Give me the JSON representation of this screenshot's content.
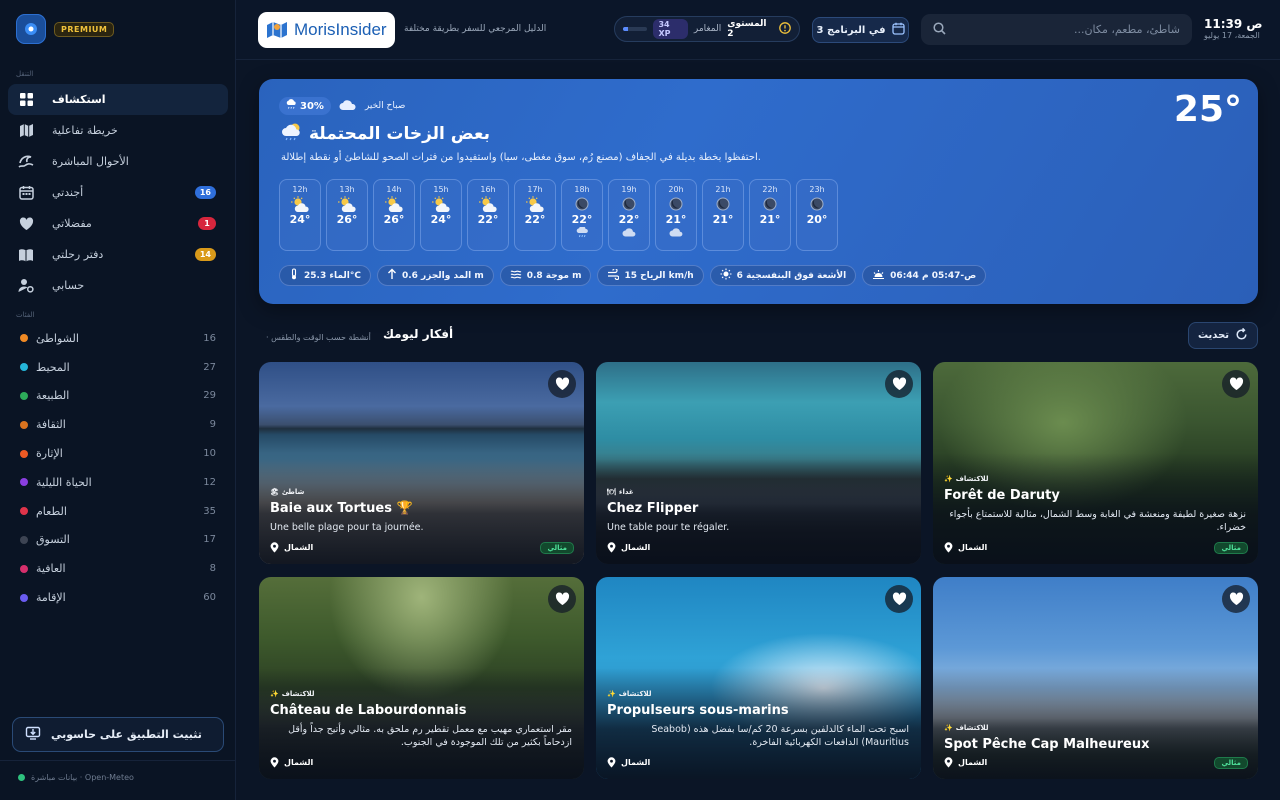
{
  "sidebar": {
    "premium": "PREMIUM",
    "nav_caption": "التنقل",
    "nav": [
      {
        "label": "استكشاف",
        "icon": "grid-icon",
        "active": true
      },
      {
        "label": "خريطة تفاعلية",
        "icon": "map-icon"
      },
      {
        "label": "الأحوال المباشرة",
        "icon": "waves-icon"
      },
      {
        "label": "أجندتي",
        "icon": "calendar-icon",
        "badge": "16",
        "badge_color": "#2f6fdb"
      },
      {
        "label": "مفضلاتي",
        "icon": "heart-icon",
        "badge": "1",
        "badge_color": "#d7263d"
      },
      {
        "label": "دفتر رحلتي",
        "icon": "book-icon",
        "badge": "14",
        "badge_color": "#d99a1a"
      },
      {
        "label": "حسابي",
        "icon": "user-gear-icon"
      }
    ],
    "cats_caption": "الفئات",
    "categories": [
      {
        "label": "الشواطئ",
        "count": "16",
        "color": "#f08a24"
      },
      {
        "label": "المحيط",
        "count": "27",
        "color": "#25b5d8"
      },
      {
        "label": "الطبيعة",
        "count": "29",
        "color": "#2dab5a"
      },
      {
        "label": "الثقافة",
        "count": "9",
        "color": "#d9731f"
      },
      {
        "label": "الإثارة",
        "count": "10",
        "color": "#ee5a24"
      },
      {
        "label": "الحياة الليلية",
        "count": "12",
        "color": "#8a3ee0"
      },
      {
        "label": "الطعام",
        "count": "35",
        "color": "#e0344a"
      },
      {
        "label": "التسوق",
        "count": "17",
        "color": "#3d4453"
      },
      {
        "label": "العافية",
        "count": "8",
        "color": "#d62f6c"
      },
      {
        "label": "الإقامة",
        "count": "60",
        "color": "#6a5cf0"
      }
    ],
    "install_label": "تثبيت التطبيق على حاسوبي",
    "footer": "بيانات مباشرة · Open-Meteo"
  },
  "header": {
    "logo_text": "MorisInsider",
    "tagline": "الدليل المرجعي للسفر بطريقة مختلفة",
    "level_label": "المستوى 2",
    "rank_label": "المغامر",
    "xp_label": "34 XP",
    "xp_progress": 0.2,
    "schedule_label": "في البرنامج 3",
    "search_placeholder": "شاطئ، مطعم، مكان...",
    "time": "11:39",
    "ampm": "ص",
    "date": "الجمعة، 17 يوليو"
  },
  "weather": {
    "greeting": "صباح الخير",
    "rain_chance": "30%",
    "title": "بعض الزخات المحتملة",
    "description": "احتفظوا بخطة بديلة في الجفاف (مصنع رُم، سوق مغطى، سبا) واستفيدوا من فترات الصحو للشاطئ أو نقطة إطلالة.",
    "temperature": "25°",
    "hours": [
      {
        "label": "12h",
        "temp": "24°",
        "icon": "sun-cloud"
      },
      {
        "label": "13h",
        "temp": "26°",
        "icon": "sun-cloud"
      },
      {
        "label": "14h",
        "temp": "26°",
        "icon": "sun-cloud"
      },
      {
        "label": "15h",
        "temp": "24°",
        "icon": "sun-cloud"
      },
      {
        "label": "16h",
        "temp": "22°",
        "icon": "sun-cloud"
      },
      {
        "label": "17h",
        "temp": "22°",
        "icon": "sun-cloud"
      },
      {
        "label": "18h",
        "temp": "22°",
        "icon": "moon",
        "sub": "rain"
      },
      {
        "label": "19h",
        "temp": "22°",
        "icon": "moon",
        "sub": "cloud"
      },
      {
        "label": "20h",
        "temp": "21°",
        "icon": "moon",
        "sub": "cloud"
      },
      {
        "label": "21h",
        "temp": "21°",
        "icon": "moon"
      },
      {
        "label": "22h",
        "temp": "21°",
        "icon": "moon"
      },
      {
        "label": "23h",
        "temp": "20°",
        "icon": "moon"
      }
    ],
    "chips": [
      {
        "label": "الماء 25.3°C",
        "icon": "thermometer-icon"
      },
      {
        "label": "المد والجزر 0.6 m",
        "icon": "arrow-up-icon"
      },
      {
        "label": "موجة 0.8 m",
        "icon": "wave-icon"
      },
      {
        "label": "الرياح 15 km/h",
        "icon": "wind-icon"
      },
      {
        "label": "الأشعة فوق البنفسجية 6",
        "icon": "sun-icon"
      },
      {
        "label": "ص-05:47 م 06:44",
        "icon": "sunrise-icon"
      }
    ]
  },
  "ideas": {
    "title": "أفكار ليومك",
    "subtitle": "· أنشطة حسب الوقت والطقس",
    "refresh_label": "تحديث",
    "cards": [
      {
        "tag": "شاطئ",
        "tag_icon": "🏖",
        "title": "Baie aux Tortues 🏆",
        "desc": "Une belle plage pour ta journée.",
        "loc": "الشمال",
        "badge": "مثالي",
        "scene": "beach"
      },
      {
        "tag": "غداء",
        "tag_icon": "🍽",
        "title": "Chez Flipper",
        "desc": "Une table pour te régaler.",
        "loc": "الشمال",
        "badge": "",
        "scene": "lagoon"
      },
      {
        "tag": "للاكتشاف",
        "tag_icon": "✨",
        "title": "Forêt de Daruty",
        "desc": "نزهة صغيرة لطيفة ومنعشة في الغابة وسط الشمال، مثالية للاستمتاع بأجواء خضراء.",
        "loc": "الشمال",
        "badge": "مثالي",
        "scene": "forest"
      },
      {
        "tag": "للاكتشاف",
        "tag_icon": "✨",
        "title": "Château de Labourdonnais",
        "desc": "مقر استعماري مهيب مع معمل تقطير رم ملحق به. مثالي وأتيح جداً وأقل ازدحاماً بكثير من تلك الموجودة في الجنوب.",
        "loc": "الشمال",
        "badge": "",
        "scene": "alley"
      },
      {
        "tag": "للاكتشاف",
        "tag_icon": "✨",
        "title": "Propulseurs sous-marins",
        "desc": "اسبح تحت الماء كالدلفين بسرعة 20 كم/سا بفضل هذه (Seabob Mauritius) الدافعات الكهربائية الفاخرة.",
        "loc": "الشمال",
        "badge": "",
        "scene": "seabob"
      },
      {
        "tag": "للاكتشاف",
        "tag_icon": "✨",
        "title": "Spot Pêche Cap Malheureux",
        "desc": "",
        "loc": "الشمال",
        "badge": "مثالي",
        "scene": "church"
      }
    ]
  }
}
